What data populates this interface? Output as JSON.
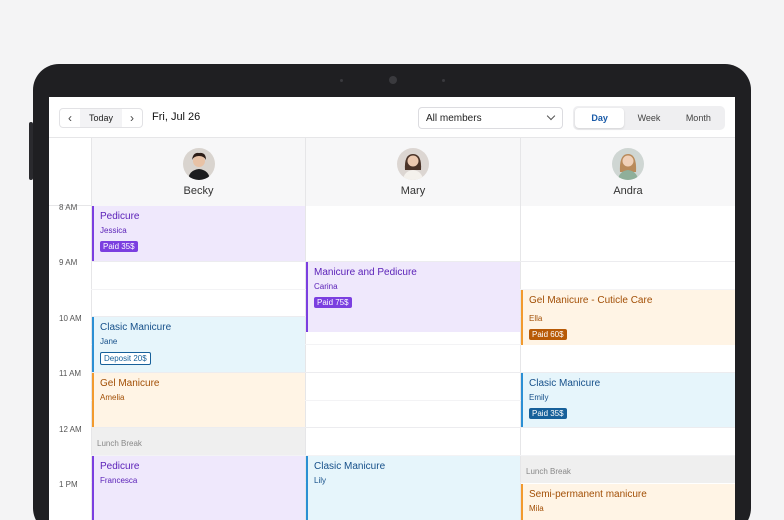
{
  "toolbar": {
    "prev_icon": "chevron-left-icon",
    "today_label": "Today",
    "next_icon": "chevron-right-icon",
    "date": "Fri, Jul 26",
    "members_filter": "All members",
    "views": [
      "Day",
      "Week",
      "Month"
    ],
    "active_view": "Day"
  },
  "staff": [
    {
      "name": "Becky"
    },
    {
      "name": "Mary"
    },
    {
      "name": "Andra"
    }
  ],
  "time_slots": [
    "8 AM",
    "9 AM",
    "10 AM",
    "11 AM",
    "12 AM",
    "1 PM"
  ],
  "appointments": {
    "becky": [
      {
        "title": "Pedicure",
        "client": "Jessica",
        "badge": "Paid 35$",
        "color": "purple"
      },
      {
        "title": "Clasic Manicure",
        "client": "Jane",
        "badge": "Deposit 20$",
        "color": "blue"
      },
      {
        "title": "Gel Manicure",
        "client": "Amelia",
        "color": "orange"
      },
      {
        "break_label": "Lunch Break"
      },
      {
        "title": "Pedicure",
        "client": "Francesca",
        "color": "purple"
      }
    ],
    "mary": [
      {
        "title": "Manicure and Pedicure",
        "client": "Carina",
        "badge": "Paid 75$",
        "color": "purple"
      },
      {
        "title": "Clasic Manicure",
        "client": "Lily",
        "color": "blue"
      }
    ],
    "andra": [
      {
        "title": "Gel Manicure - Cuticle Care",
        "client": "Ella",
        "badge": "Paid 60$",
        "color": "orange"
      },
      {
        "title": "Clasic Manicure",
        "client": "Emily",
        "badge": "Paid 35$",
        "color": "blue"
      },
      {
        "break_label": "Lunch Break"
      },
      {
        "title": "Semi-permanent manicure",
        "client": "Mila",
        "color": "orange"
      }
    ]
  },
  "colors": {
    "purple": "#7b3fe0",
    "blue": "#2b8fd4",
    "orange": "#f29a2e",
    "accent": "#1a5ba8"
  }
}
